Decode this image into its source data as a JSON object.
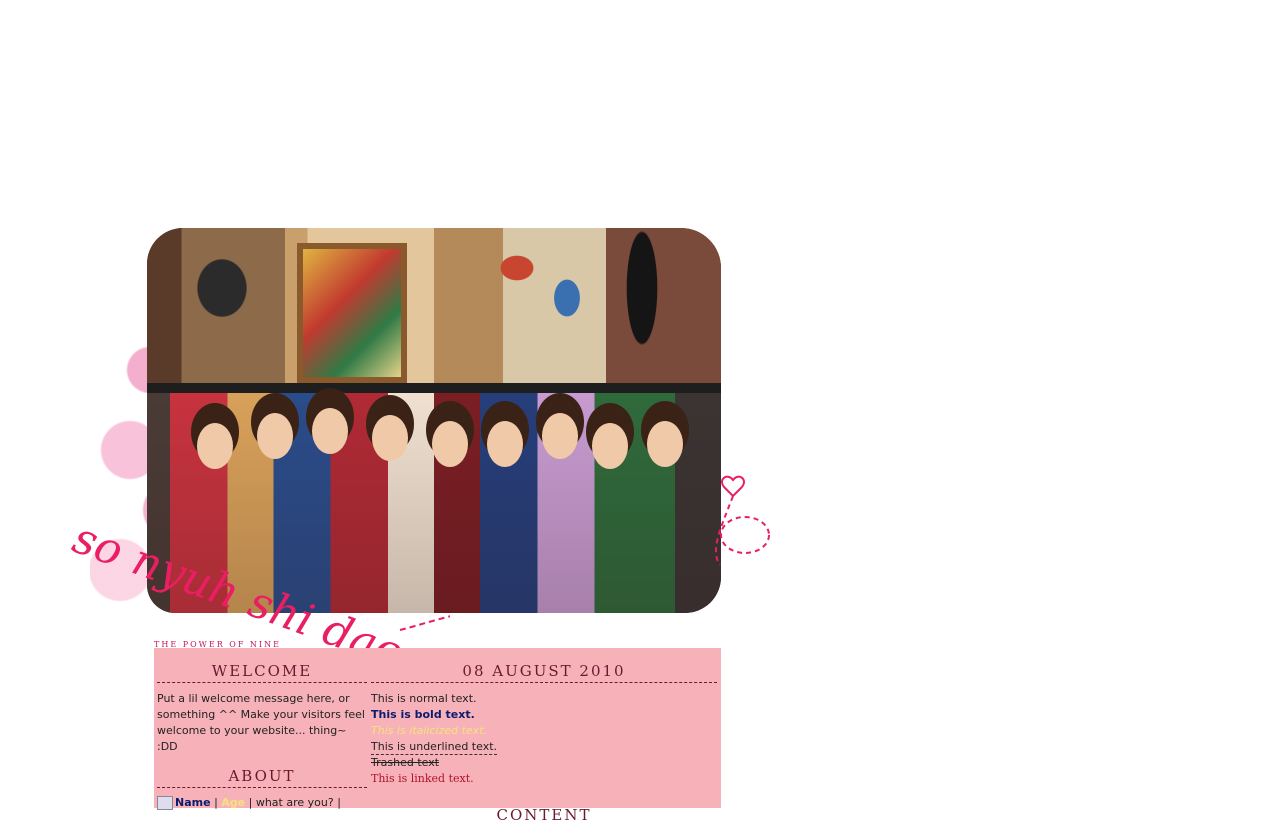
{
  "tagline": "THE POWER OF NINE",
  "logo_text": "so nyuh shi dae",
  "sidebar": {
    "welcome_heading": "WELCOME",
    "welcome_text": "Put a lil welcome message here, or something ^^ Make your visitors feel welcome to your website... thing~ :DD",
    "about_heading": "ABOUT",
    "nav": {
      "name": "Name",
      "sep1": "|",
      "age": "Age",
      "sep2": "| what are you? |"
    }
  },
  "main": {
    "date_heading": "08 AUGUST 2010",
    "normal_text": "This is normal text.",
    "bold_text": "This is bold text.",
    "italic_text": "This is italicized text.",
    "underline_text": "This is underlined text.",
    "strike_text": "Trashed text",
    "linked_text": "This is linked text.",
    "content_heading": "CONTENT"
  },
  "colors": {
    "content_bg": "#f7b1b9",
    "heading": "#6b1a2e",
    "accent_pink": "#e91e63",
    "bold_blue": "#0b1b6e",
    "italic_yellow": "#f6e27a",
    "link_red": "#b3122a"
  }
}
